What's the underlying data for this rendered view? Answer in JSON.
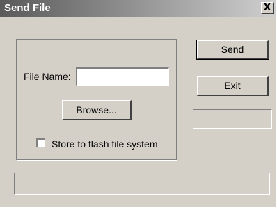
{
  "window": {
    "title": "Send File",
    "close_icon": "close-icon",
    "close_glyph": "X"
  },
  "form": {
    "file_name_label": "File Name:",
    "file_name_value": "",
    "browse_label": "Browse...",
    "store_flash_label": "Store to flash file system",
    "store_flash_checked": false
  },
  "actions": {
    "send_label": "Send",
    "exit_label": "Exit"
  },
  "status": {
    "progress_text": "",
    "status_bar_text": ""
  }
}
